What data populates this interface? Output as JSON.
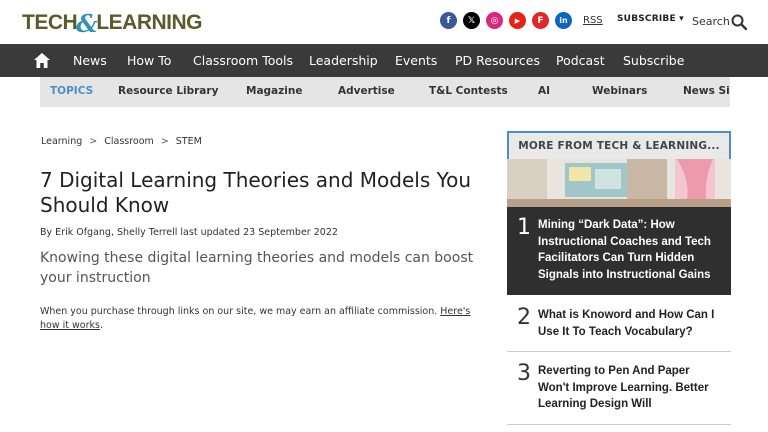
{
  "header": {
    "logo_left": "TECH",
    "logo_amp": "&",
    "logo_right": "LEARNING",
    "social": [
      {
        "name": "facebook-icon",
        "glyph": "f",
        "color": "#3b5998"
      },
      {
        "name": "x-icon",
        "glyph": "𝕏",
        "color": "#000000"
      },
      {
        "name": "instagram-icon",
        "glyph": "◎",
        "color": "#d6297e"
      },
      {
        "name": "youtube-icon",
        "glyph": "▶",
        "color": "#e62117"
      },
      {
        "name": "flipboard-icon",
        "glyph": "F",
        "color": "#e12828"
      },
      {
        "name": "linkedin-icon",
        "glyph": "in",
        "color": "#0a66c2"
      }
    ],
    "rss": "RSS",
    "subscribe": "SUBSCRIBE ▾",
    "search": "Search"
  },
  "nav": {
    "items": [
      "News",
      "How To",
      "Classroom Tools",
      "Leadership",
      "Events",
      "PD Resources",
      "Podcast",
      "Subscribe"
    ]
  },
  "topics": {
    "label": "TOPICS",
    "items": [
      "Resource Library",
      "Magazine",
      "Advertise",
      "T&L Contests",
      "AI",
      "Webinars",
      "News Sig"
    ]
  },
  "article": {
    "breadcrumb": [
      "Learning",
      "Classroom",
      "STEM"
    ],
    "breadcrumb_sep": ">",
    "title": "7 Digital Learning Theories and Models You Should Know",
    "byline": "By Erik Ofgang, Shelly Terrell last updated 23 September 2022",
    "strap": "Knowing these digital learning theories and models can boost your instruction",
    "affiliate_text": "When you purchase through links on our site, we may earn an affiliate commission. ",
    "affiliate_link": "Here's how it works",
    "affiliate_end": "."
  },
  "sidebar": {
    "heading": "MORE FROM TECH & LEARNING...",
    "items": [
      {
        "num": "1",
        "text": "Mining “Dark Data”: How Instructional Coaches and Tech Facilitators Can Turn Hidden Signals into Instructional Gains"
      },
      {
        "num": "2",
        "text": "What is Knoword and How Can I Use It To Teach Vocabulary?"
      },
      {
        "num": "3",
        "text": "Reverting to Pen And Paper Won't Improve Learning. Better Learning Design Will"
      }
    ]
  }
}
